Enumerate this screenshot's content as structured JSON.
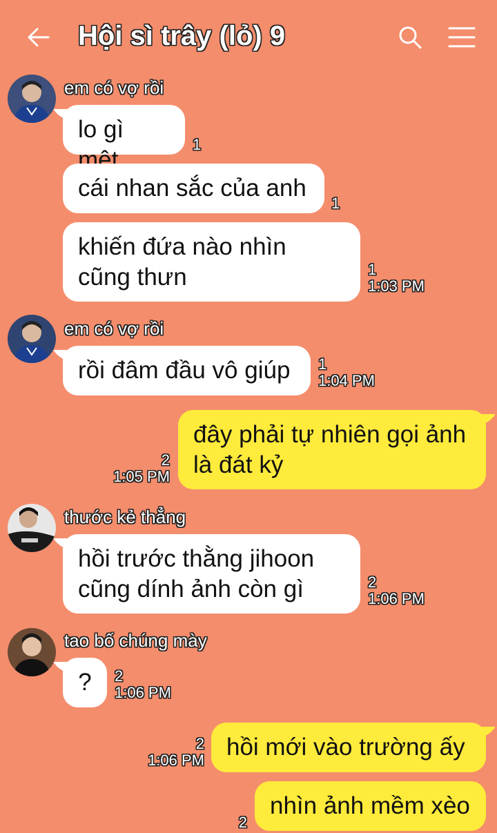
{
  "header": {
    "title": "Hội sì trây (lỏ) 9",
    "back_icon": "arrow-left-icon",
    "search_icon": "search-icon",
    "menu_icon": "hamburger-menu-icon"
  },
  "colors": {
    "background": "#f48d6c",
    "received_bubble": "#ffffff",
    "sent_bubble": "#ffeb3b"
  },
  "messages": [
    {
      "sender": "em có vợ rồi",
      "text": "lo gì mệt",
      "unread": "1",
      "time": ""
    },
    {
      "text": "cái nhan sắc của anh",
      "unread": "1",
      "time": ""
    },
    {
      "text_lines": [
        "khiến đứa nào nhìn",
        "cũng thưn"
      ],
      "unread": "1",
      "time": "1:03 PM"
    },
    {
      "sender": "em có vợ rồi",
      "text": "rồi đâm đầu vô giúp",
      "unread": "1",
      "time": "1:04 PM"
    },
    {
      "text_lines": [
        "đây phải tự nhiên gọi ảnh",
        "là đát kỷ"
      ],
      "unread": "2",
      "time": "1:05 PM"
    },
    {
      "sender": "thước kẻ thẳng",
      "text_lines": [
        "hồi trước thằng jihoon",
        "cũng dính ảnh còn gì"
      ],
      "unread": "2",
      "time": "1:06 PM"
    },
    {
      "sender": "tao bố chúng mày",
      "text": "?",
      "unread": "2",
      "time": "1:06 PM"
    },
    {
      "text": "hồi mới vào trường ấy",
      "unread": "2",
      "time": "1:06 PM"
    },
    {
      "text": "nhìn ảnh mềm xèo",
      "unread": "2",
      "time": ""
    }
  ]
}
